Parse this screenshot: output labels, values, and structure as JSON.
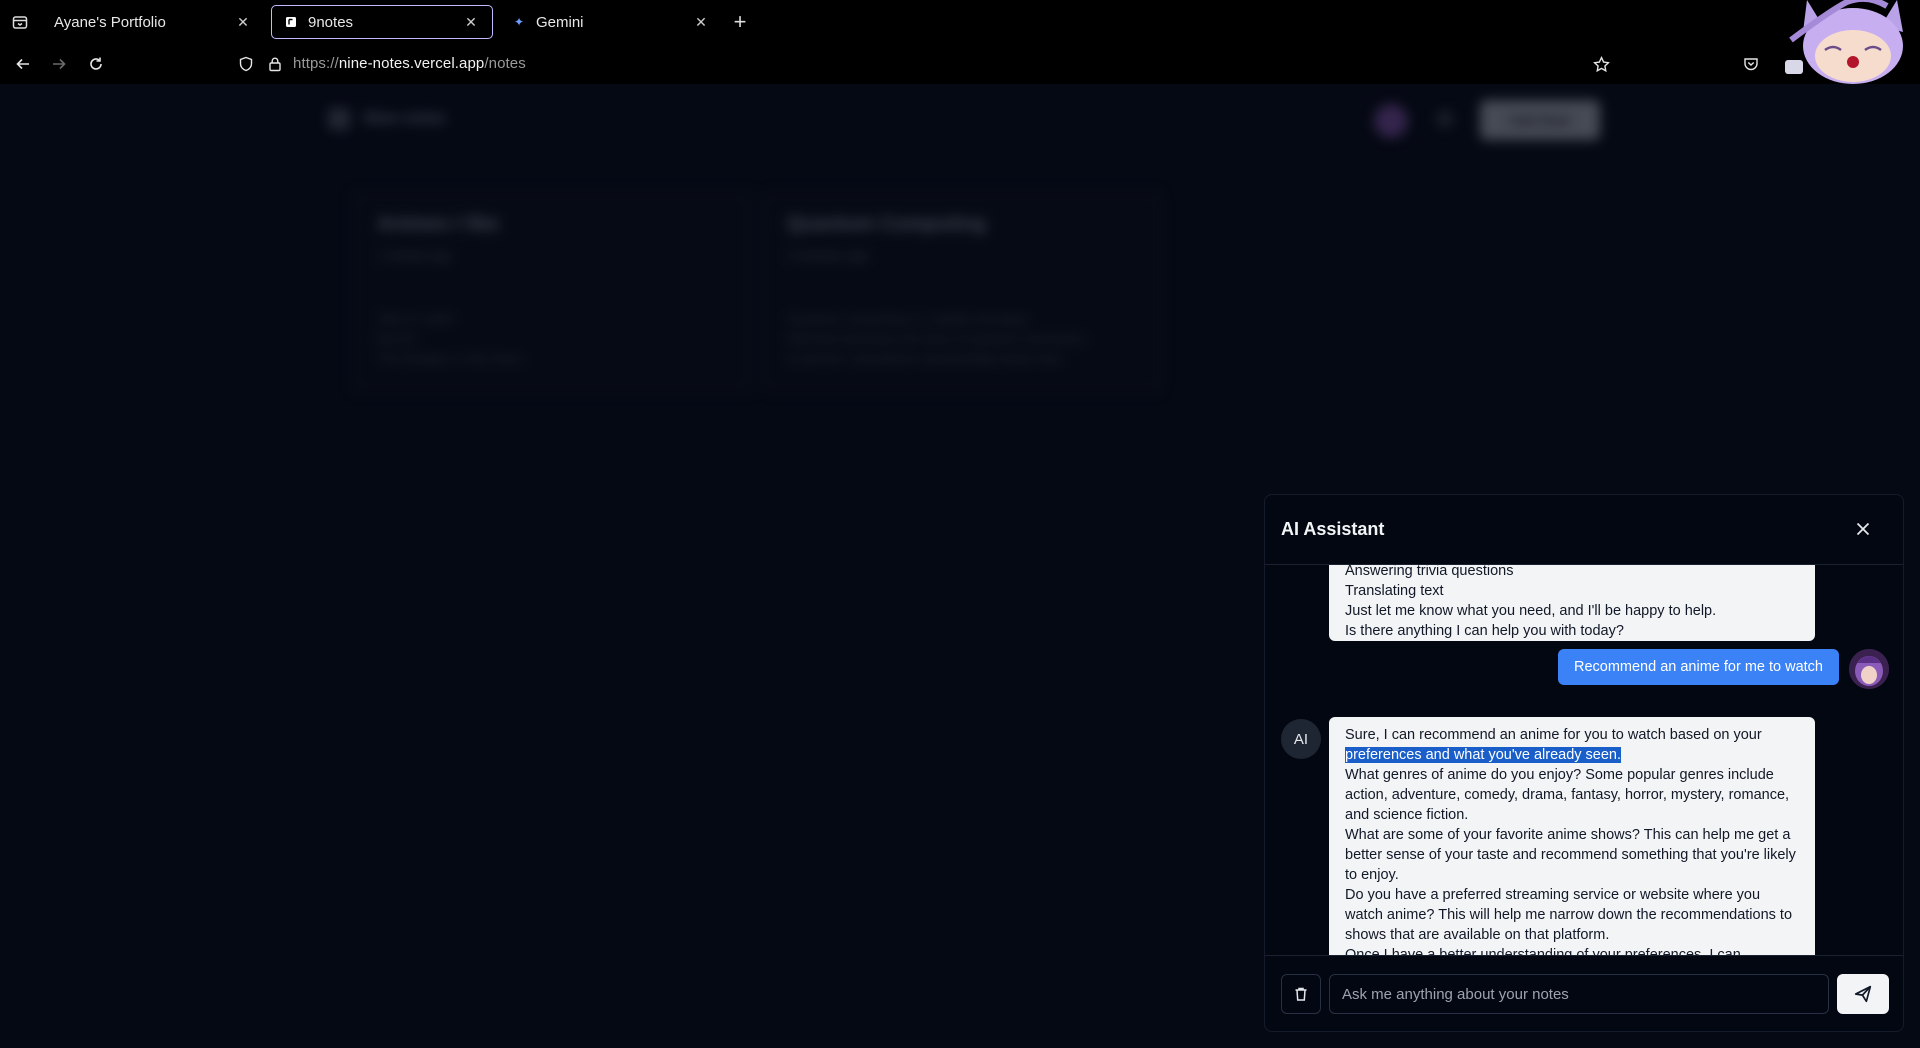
{
  "browser": {
    "tabs": [
      {
        "title": "Ayane's Portfolio",
        "active": false
      },
      {
        "title": "9notes",
        "active": true
      },
      {
        "title": "Gemini",
        "active": false
      }
    ],
    "url_prefix": "https://",
    "url_host": "nine-notes.vercel.app",
    "url_path": "/notes"
  },
  "app": {
    "title": "Nine notes",
    "new_note_label": "Add Note",
    "notes": [
      {
        "title": "Animes I like",
        "time": "1 minute ago",
        "body_lines": [
          "Skip & Loafer",
          "Bocchi",
          "The Dangers in My Heart"
        ]
      },
      {
        "title": "Quantum Computing",
        "time": "3 minutes ago",
        "body_lines": [
          "Quantum computing is a rapidly emerging",
          "field that harnesses the laws of quantum mechanics",
          "to perform calculations exponentially faster than"
        ]
      }
    ]
  },
  "assistant": {
    "title": "AI Assistant",
    "ai_avatar_label": "AI",
    "messages": {
      "first_ai_lines": [
        "Answering trivia questions",
        "Translating text",
        "Just let me know what you need, and I'll be happy to help.",
        "Is there anything I can help you with today?"
      ],
      "user_message": "Recommend an anime for me to watch",
      "second_ai": {
        "line1": "Sure, I can recommend an anime for you to watch based on your",
        "line1_highlight": "preferences and what you've already seen.",
        "paragraphs": [
          "What genres of anime do you enjoy? Some popular genres include action, adventure, comedy, drama, fantasy, horror, mystery, romance, and science fiction.",
          "What are some of your favorite anime shows? This can help me get a better sense of your taste and recommend something that you're likely to enjoy.",
          "Do you have a preferred streaming service or website where you watch anime? This will help me narrow down the recommendations to shows that are available on that platform.",
          "Once I have a better understanding of your preferences, I can"
        ]
      }
    },
    "input_placeholder": "Ask me anything about your notes",
    "input_value": ""
  }
}
